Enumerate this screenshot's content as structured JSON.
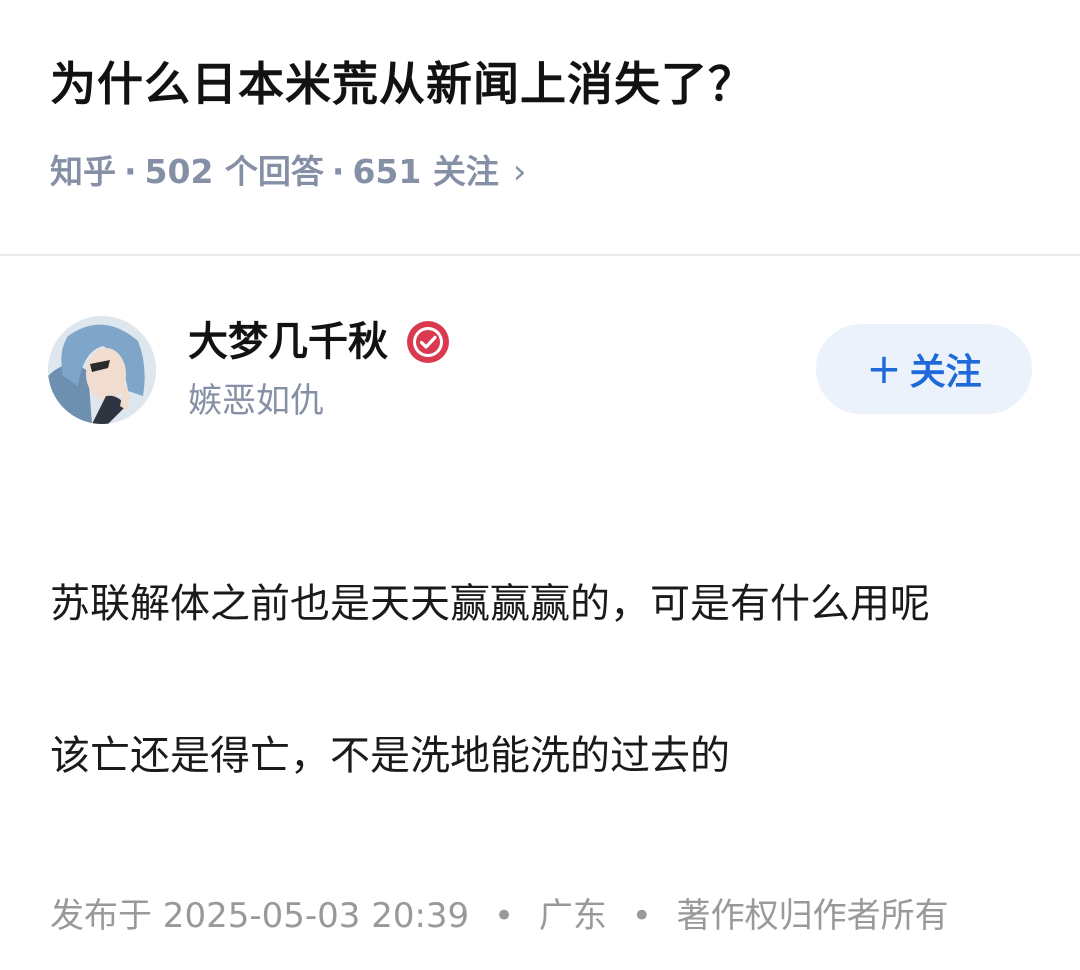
{
  "question": {
    "title": "为什么日本米荒从新闻上消失了？",
    "source": "知乎",
    "answers_count": "502 个回答",
    "followers_count": "651 关注",
    "separator": "·",
    "chevron": "›"
  },
  "author": {
    "name": "大梦几千秋",
    "bio": "嫉恶如仇",
    "verified_icon": "verified-badge-icon",
    "follow_button": {
      "plus": "+",
      "label": "关注"
    }
  },
  "answer": {
    "paragraphs": [
      "苏联解体之前也是天天赢赢赢的，可是有什么用呢",
      "该亡还是得亡，不是洗地能洗的过去的"
    ],
    "footer": {
      "published": "发布于 2025-05-03 20:39",
      "location": "广东",
      "copyright": "著作权归作者所有",
      "separator": "•"
    }
  },
  "colors": {
    "accent": "#1f6ad8",
    "follow_bg": "#ebf2fc",
    "meta_gray": "#8590a6",
    "verified_red": "#d93a50"
  }
}
